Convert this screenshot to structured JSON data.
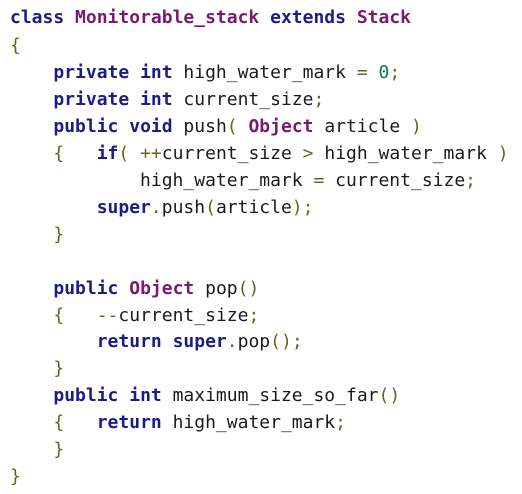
{
  "lines": [
    [
      [
        "kw",
        "class"
      ],
      [
        "id",
        " "
      ],
      [
        "ty",
        "Monitorable_stack"
      ],
      [
        "id",
        " "
      ],
      [
        "kw",
        "extends"
      ],
      [
        "id",
        " "
      ],
      [
        "ty",
        "Stack"
      ]
    ],
    [
      [
        "op",
        "{"
      ]
    ],
    [
      [
        "id",
        "    "
      ],
      [
        "kw",
        "private"
      ],
      [
        "id",
        " "
      ],
      [
        "kw",
        "int"
      ],
      [
        "id",
        " high_water_mark "
      ],
      [
        "op",
        "="
      ],
      [
        "id",
        " "
      ],
      [
        "num",
        "0"
      ],
      [
        "op",
        ";"
      ]
    ],
    [
      [
        "id",
        "    "
      ],
      [
        "kw",
        "private"
      ],
      [
        "id",
        " "
      ],
      [
        "kw",
        "int"
      ],
      [
        "id",
        " current_size"
      ],
      [
        "op",
        ";"
      ]
    ],
    [
      [
        "id",
        "    "
      ],
      [
        "kw",
        "public"
      ],
      [
        "id",
        " "
      ],
      [
        "kw",
        "void"
      ],
      [
        "id",
        " push"
      ],
      [
        "op",
        "("
      ],
      [
        "id",
        " "
      ],
      [
        "ty",
        "Object"
      ],
      [
        "id",
        " article "
      ],
      [
        "op",
        ")"
      ]
    ],
    [
      [
        "id",
        "    "
      ],
      [
        "op",
        "{"
      ],
      [
        "id",
        "   "
      ],
      [
        "kw",
        "if"
      ],
      [
        "op",
        "("
      ],
      [
        "id",
        " "
      ],
      [
        "op",
        "++"
      ],
      [
        "id",
        "current_size "
      ],
      [
        "op",
        ">"
      ],
      [
        "id",
        " high_water_mark "
      ],
      [
        "op",
        ")"
      ]
    ],
    [
      [
        "id",
        "            high_water_mark "
      ],
      [
        "op",
        "="
      ],
      [
        "id",
        " current_size"
      ],
      [
        "op",
        ";"
      ]
    ],
    [
      [
        "id",
        "        "
      ],
      [
        "kw",
        "super"
      ],
      [
        "op",
        "."
      ],
      [
        "id",
        "push"
      ],
      [
        "op",
        "("
      ],
      [
        "id",
        "article"
      ],
      [
        "op",
        ")"
      ],
      [
        "op",
        ";"
      ]
    ],
    [
      [
        "id",
        "    "
      ],
      [
        "op",
        "}"
      ]
    ],
    [],
    [
      [
        "id",
        "    "
      ],
      [
        "kw",
        "public"
      ],
      [
        "id",
        " "
      ],
      [
        "ty",
        "Object"
      ],
      [
        "id",
        " pop"
      ],
      [
        "op",
        "()"
      ]
    ],
    [
      [
        "id",
        "    "
      ],
      [
        "op",
        "{"
      ],
      [
        "id",
        "   "
      ],
      [
        "op",
        "--"
      ],
      [
        "id",
        "current_size"
      ],
      [
        "op",
        ";"
      ]
    ],
    [
      [
        "id",
        "        "
      ],
      [
        "kw",
        "return"
      ],
      [
        "id",
        " "
      ],
      [
        "kw",
        "super"
      ],
      [
        "op",
        "."
      ],
      [
        "id",
        "pop"
      ],
      [
        "op",
        "()"
      ],
      [
        "op",
        ";"
      ]
    ],
    [
      [
        "id",
        "    "
      ],
      [
        "op",
        "}"
      ]
    ],
    [
      [
        "id",
        "    "
      ],
      [
        "kw",
        "public"
      ],
      [
        "id",
        " "
      ],
      [
        "kw",
        "int"
      ],
      [
        "id",
        " maximum_size_so_far"
      ],
      [
        "op",
        "()"
      ]
    ],
    [
      [
        "id",
        "    "
      ],
      [
        "op",
        "{"
      ],
      [
        "id",
        "   "
      ],
      [
        "kw",
        "return"
      ],
      [
        "id",
        " high_water_mark"
      ],
      [
        "op",
        ";"
      ]
    ],
    [
      [
        "id",
        "    "
      ],
      [
        "op",
        "}"
      ]
    ],
    [
      [
        "op",
        "}"
      ]
    ]
  ]
}
